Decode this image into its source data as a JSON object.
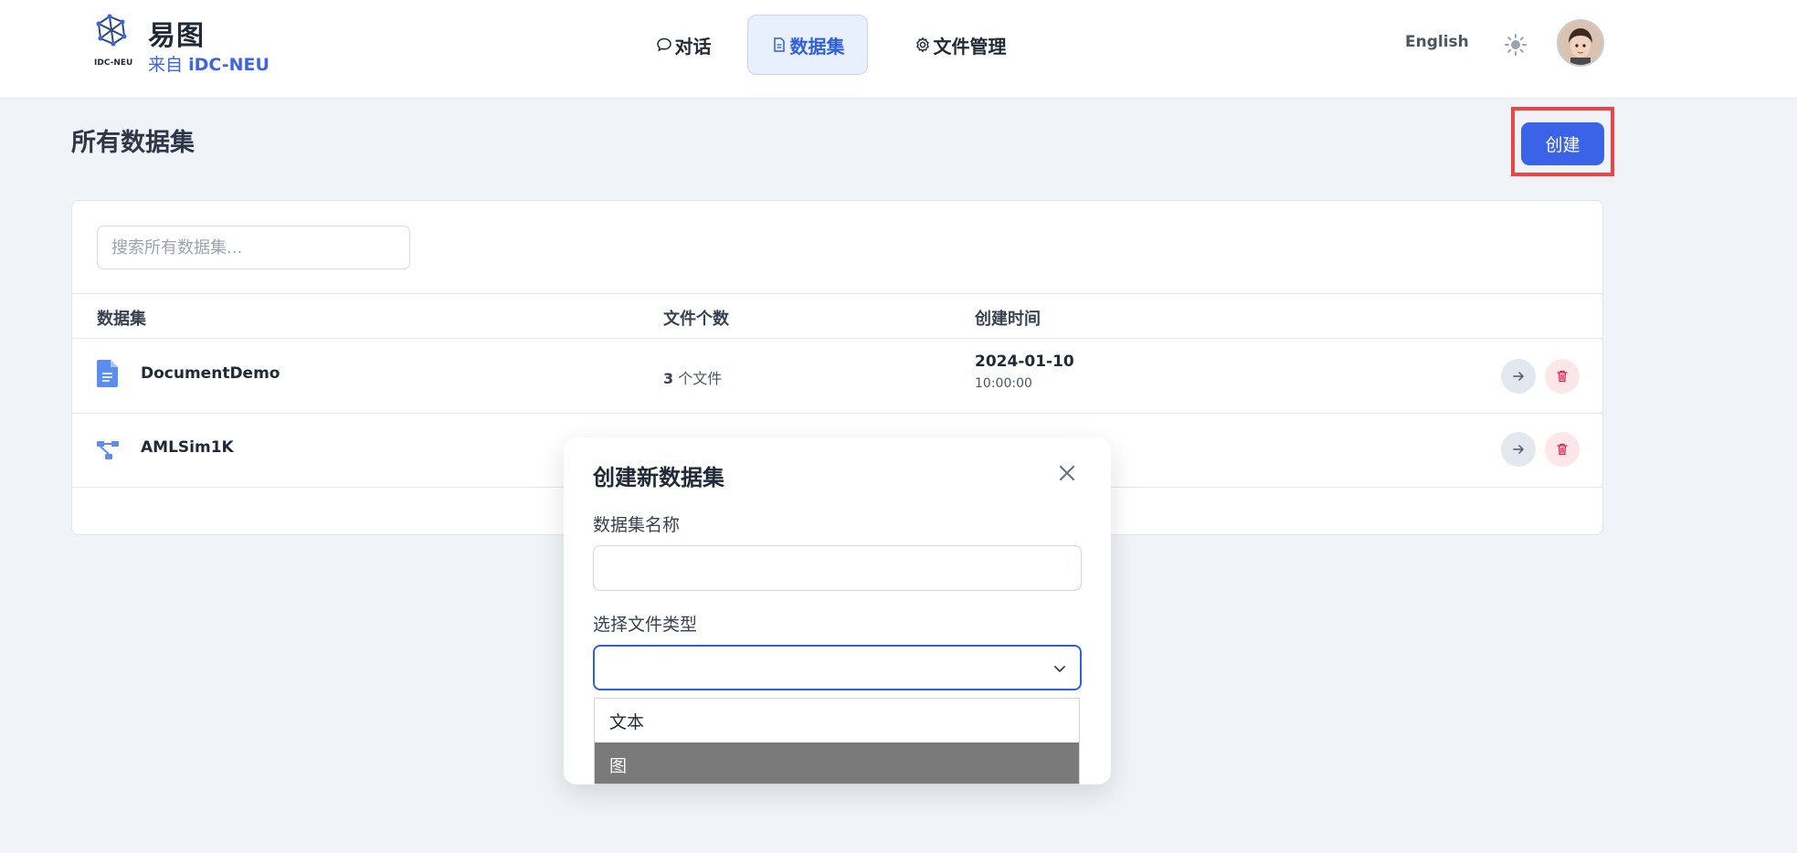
{
  "brand": {
    "logo_text": "IDC-NEU",
    "title": "易图",
    "sub_prefix": "来自",
    "sub_name": "iDC-NEU"
  },
  "nav": {
    "items": [
      {
        "label": "对话",
        "icon": "chat-bubble-icon"
      },
      {
        "label": "数据集",
        "icon": "document-icon",
        "active": true
      },
      {
        "label": "文件管理",
        "icon": "gear-icon"
      }
    ]
  },
  "header_right": {
    "language": "English",
    "theme_icon": "sun-icon",
    "avatar_icon": "user-avatar"
  },
  "page": {
    "title": "所有数据集",
    "create_label": "创建"
  },
  "search": {
    "placeholder": "搜索所有数据集..."
  },
  "table": {
    "columns": [
      "数据集",
      "文件个数",
      "创建时间"
    ],
    "rows": [
      {
        "name": "DocumentDemo",
        "icon": "document-icon",
        "file_count": "3",
        "file_unit": "个文件",
        "date": "2024-01-10",
        "time": "10:00:00"
      },
      {
        "name": "AMLSim1K",
        "icon": "graph-icon"
      }
    ]
  },
  "modal": {
    "title": "创建新数据集",
    "name_label": "数据集名称",
    "name_value": "",
    "type_label": "选择文件类型",
    "type_value": "",
    "options": [
      "文本",
      "图"
    ],
    "highlighted_option": "图"
  },
  "colors": {
    "accent": "#3a63e7",
    "highlight_border": "#ef4444",
    "option_highlight": "#7a7a7a"
  }
}
